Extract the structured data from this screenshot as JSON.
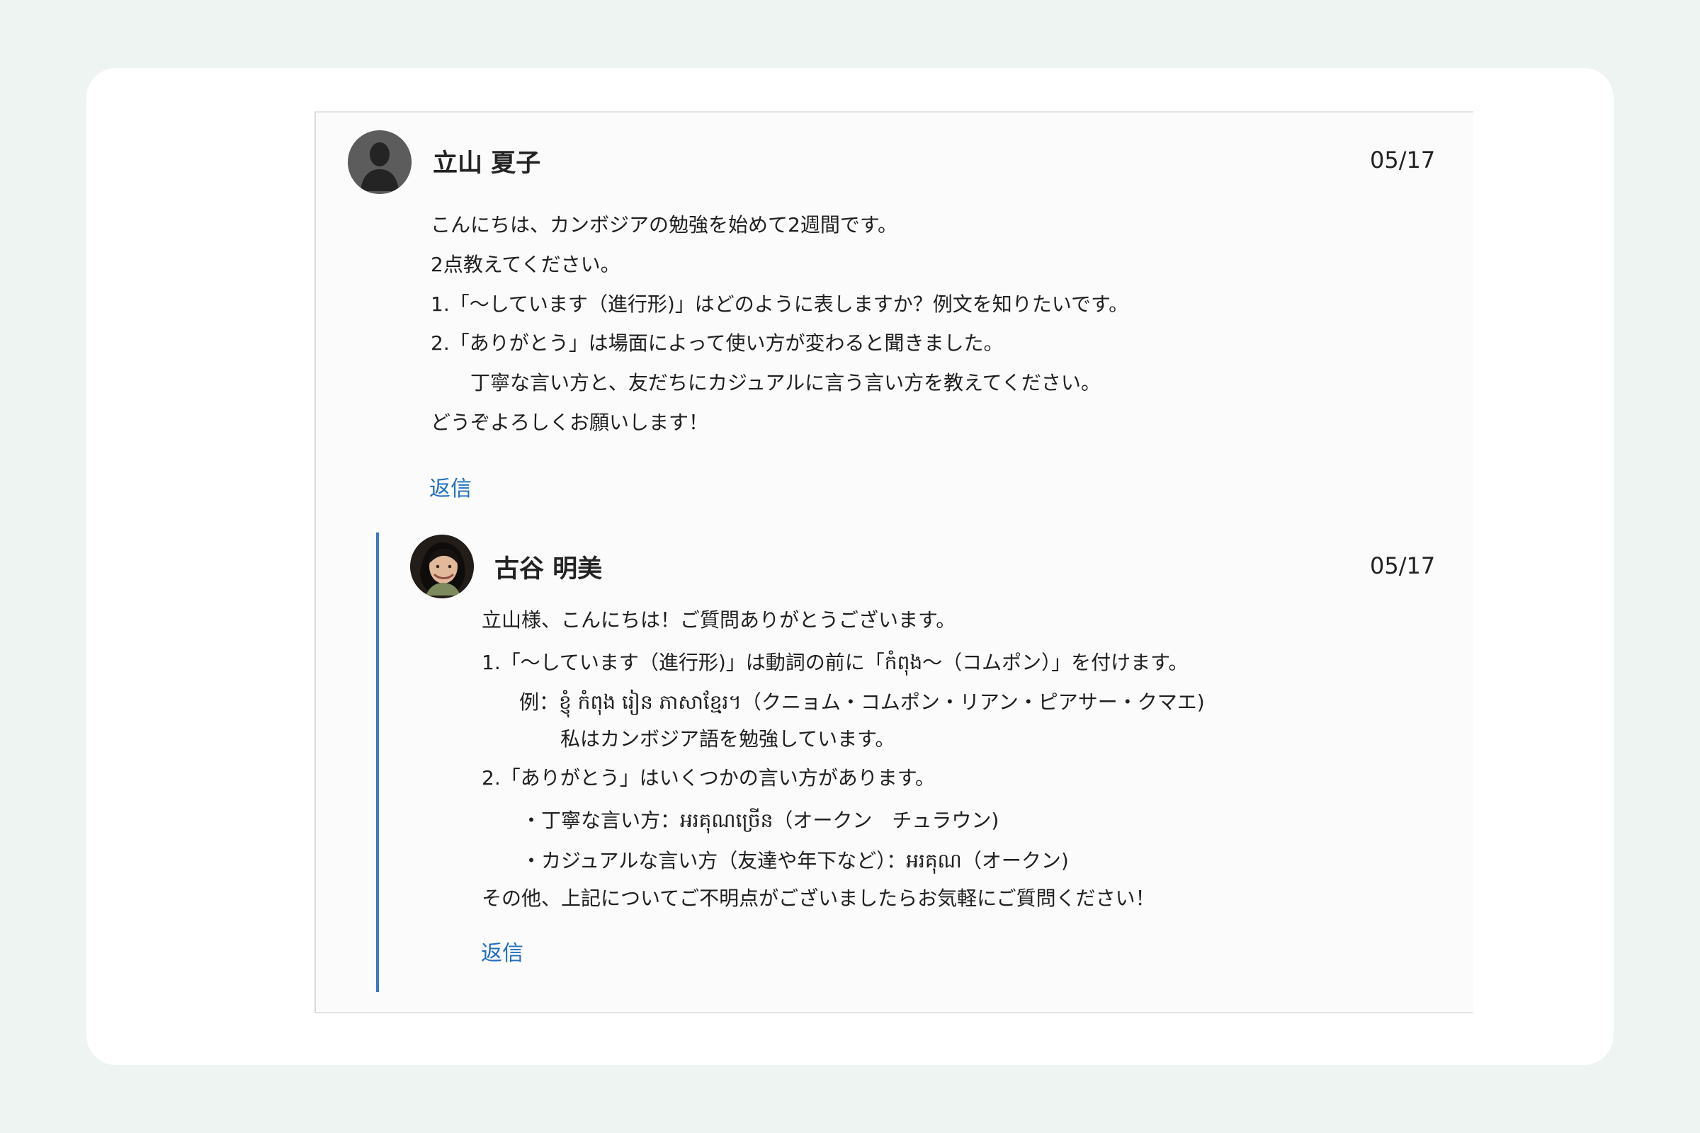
{
  "thread": {
    "post": {
      "author": "立山 夏子",
      "date": "05/17",
      "avatar_icon": "default-user-icon",
      "lines": [
        "こんにちは、カンボジアの勉強を始めて2週間です。",
        "2点教えてください。",
        "1.「〜しています（進行形)」はどのように表しますか？例文を知りたいです。",
        "2.「ありがとう」は場面によって使い方が変わると聞きました。",
        "丁寧な言い方と、友だちにカジュアルに言う言い方を教えてください。",
        "どうぞよろしくお願いします！"
      ],
      "reply_label": "返信"
    },
    "reply": {
      "author": "古谷 明美",
      "date": "05/17",
      "avatar_icon": "user-photo-avatar",
      "lines": [
        "立山様、こんにちは！ご質問ありがとうございます。",
        "1.「〜しています（進行形)」は動詞の前に「កំពុង〜（コムポン）」を付けます。",
        "例：ខ្ញុំ កំពុង រៀន ភាសាខ្មែរ។（クニョム・コムポン・リアン・ピアサー・クマエ)",
        "私はカンボジア語を勉強しています。",
        "2.「ありがとう」はいくつかの言い方があります。",
        "・丁寧な言い方：អរគុណច្រើន（オークン　チュラウン)",
        "・カジュアルな言い方（友達や年下など）：អរគុណ（オークン)",
        "その他、上記についてご不明点がございましたらお気軽にご質問ください！"
      ],
      "reply_label": "返信"
    }
  },
  "colors": {
    "page_background": "#edf4f1",
    "card_background": "#ffffff",
    "thread_background": "#fbfbfb",
    "link": "#1f6fc1",
    "reply_rail": "#3d76c8"
  }
}
